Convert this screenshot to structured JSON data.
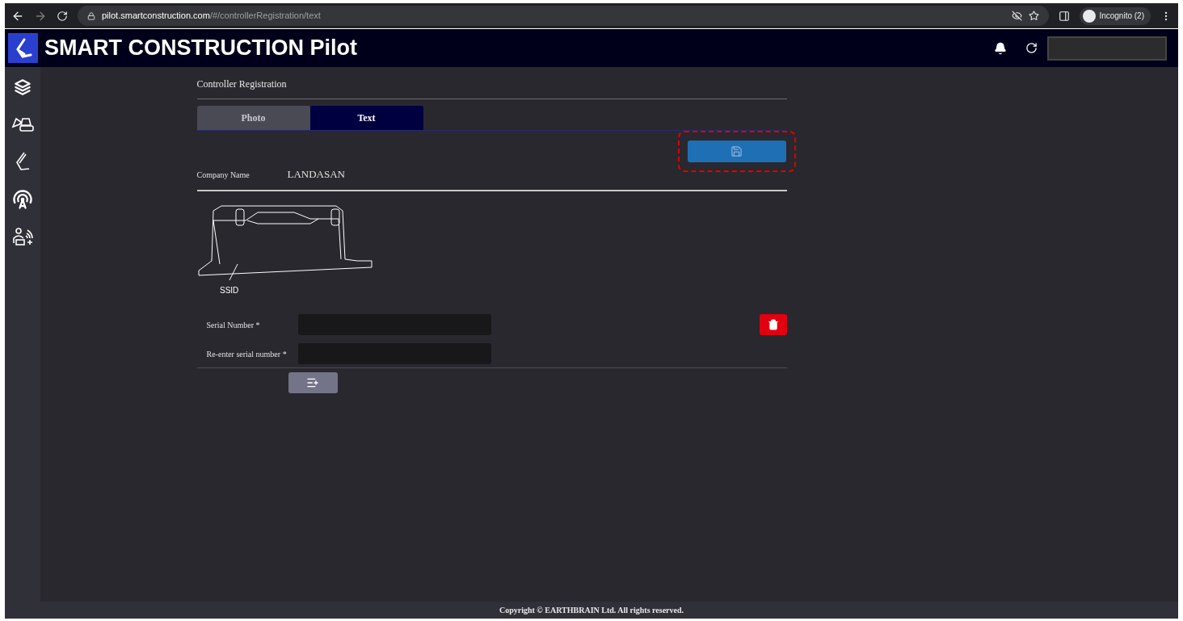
{
  "browser": {
    "url_host": "pilot.smartconstruction.com",
    "url_path": "/#/controllerRegistration/text",
    "profile": "Incognito (2)"
  },
  "header": {
    "title": "SMART CONSTRUCTION Pilot"
  },
  "page": {
    "title": "Controller Registration",
    "tabs": [
      {
        "label": "Photo",
        "selected": false
      },
      {
        "label": "Text",
        "selected": true
      }
    ],
    "save_highlighted": true,
    "company": {
      "label": "Company Name",
      "value": "LANDASAN"
    },
    "figure_label": "SSID",
    "fields": [
      {
        "label": "Serial Number *"
      },
      {
        "label": "Re-enter serial number *"
      }
    ]
  },
  "footer": "Copyright © EARTHBRAIN Ltd. All rights reserved."
}
